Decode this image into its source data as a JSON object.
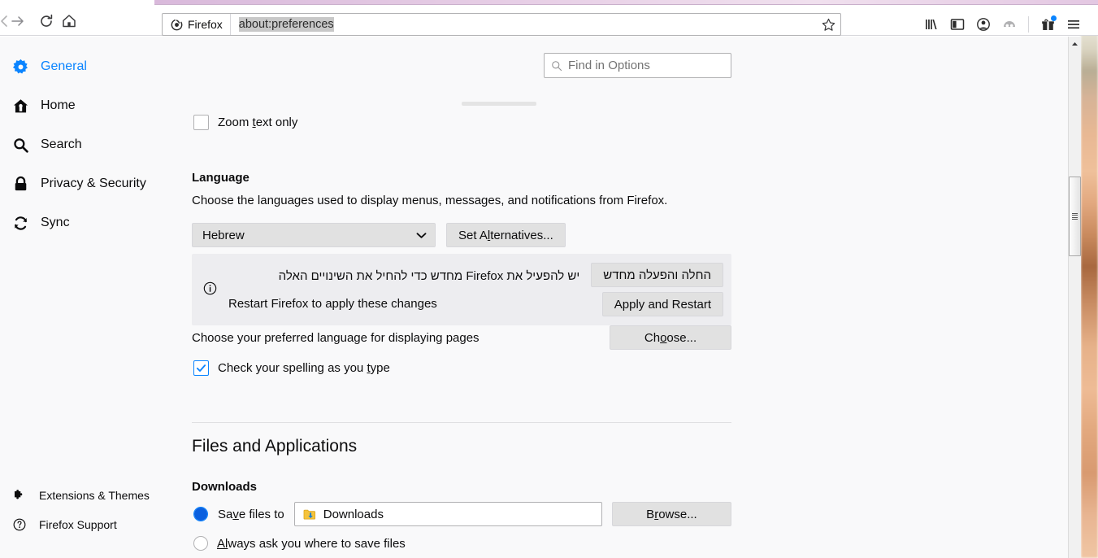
{
  "browser": {
    "nav": {
      "back": "back-arrow",
      "forward": "forward-arrow",
      "reload": "reload-icon",
      "home": "home-icon"
    },
    "urlbar": {
      "chip_label": "Firefox",
      "url": "about:preferences",
      "bookmark_icon": "star-icon"
    },
    "toolbar_icons": [
      "library-icon",
      "sidebar-icon",
      "account-icon",
      "container-tabs-icon",
      "gift-icon",
      "hamburger-menu-icon"
    ]
  },
  "search": {
    "placeholder": "Find in Options",
    "icon": "search-icon"
  },
  "sidebar": {
    "items": [
      {
        "label": "General",
        "icon": "gear-icon",
        "selected": true
      },
      {
        "label": "Home",
        "icon": "home-icon",
        "selected": false
      },
      {
        "label": "Search",
        "icon": "search-icon",
        "selected": false
      },
      {
        "label": "Privacy & Security",
        "icon": "lock-icon",
        "selected": false
      },
      {
        "label": "Sync",
        "icon": "sync-icon",
        "selected": false
      }
    ],
    "bottom_items": [
      {
        "label": "Extensions & Themes",
        "icon": "puzzle-piece-icon"
      },
      {
        "label": "Firefox Support",
        "icon": "question-circle-icon"
      }
    ]
  },
  "main": {
    "zoom_text_only": {
      "label_pre": "Zoom ",
      "accesskey": "t",
      "label_post": "ext only",
      "checked": false
    },
    "language": {
      "heading": "Language",
      "description": "Choose the languages used to display menus, messages, and notifications from Firefox.",
      "selected_language": "Hebrew",
      "dropdown_icon": "chevron-down-icon",
      "set_alternatives": {
        "pre": "Set A",
        "accesskey": "l",
        "post": "ternatives..."
      },
      "notification": {
        "icon": "info-icon",
        "line_hebrew": "יש להפעיל את Firefox מחדש כדי להחיל את השינויים האלה",
        "line_english": "Restart Firefox to apply these changes",
        "button_hebrew": "החלה והפעלה מחדש",
        "button_english": "Apply and Restart"
      },
      "preferred_pages_label": "Choose your preferred language for displaying pages",
      "choose_button": {
        "pre": "Ch",
        "accesskey": "o",
        "post": "ose..."
      },
      "spellcheck": {
        "label_pre": "Check your spelling as you ",
        "accesskey": "t",
        "label_post": "ype",
        "checked": true
      }
    },
    "files_and_applications": {
      "heading": "Files and Applications",
      "downloads": {
        "heading": "Downloads",
        "save_files_to": {
          "label_pre": "Sa",
          "accesskey": "v",
          "label_post": "e files to",
          "selected": true
        },
        "folder_icon": "downloads-folder-icon",
        "folder_path": "Downloads",
        "browse_button": {
          "pre": "B",
          "accesskey": "r",
          "post": "owse..."
        },
        "always_ask": {
          "label_pre": "A",
          "accesskey": "l",
          "label_post": "ways ask you where to save files",
          "selected": false
        }
      }
    }
  },
  "scrollbar": {
    "up_arrow": "scroll-up-arrow",
    "thumb": "scrollbar-thumb"
  },
  "colors": {
    "accent": "#0a84ff",
    "page_bg": "#f9f9fa",
    "notification_bg": "#ededf0",
    "button_bg": "#e1e1e1"
  }
}
